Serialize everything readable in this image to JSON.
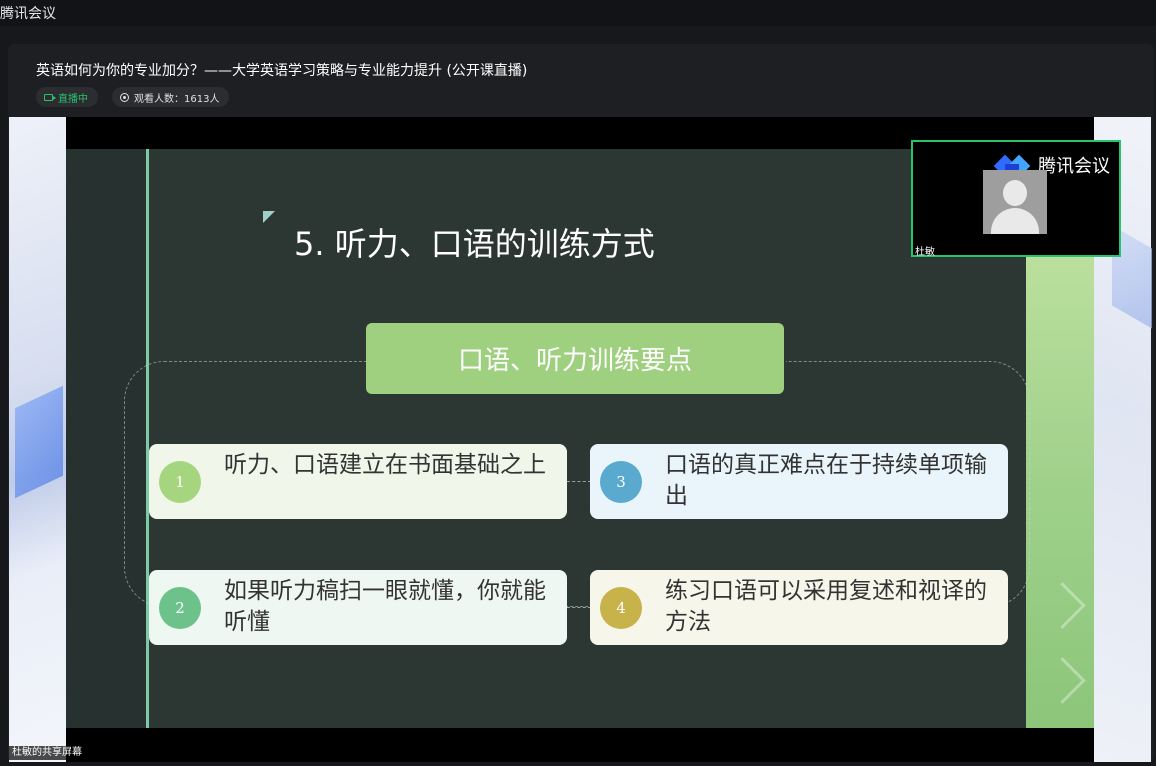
{
  "app": {
    "title": "腾讯会议"
  },
  "meeting": {
    "title": "英语如何为你的专业加分？——大学英语学习策略与专业能力提升 (公开课直播)",
    "live_label": "直播中",
    "viewers_label": "观看人数：1613人"
  },
  "share": {
    "label": "杜敏的共享屏幕"
  },
  "video_tile": {
    "logo_text": "腾讯会议",
    "name": "杜敏"
  },
  "slide": {
    "heading": "5. 听力、口语的训练方式",
    "banner": "口语、听力训练要点",
    "points": [
      {
        "num": "1",
        "text": "听力、口语建立在书面基础之上"
      },
      {
        "num": "2",
        "text": "如果听力稿扫一眼就懂，你就能听懂"
      },
      {
        "num": "3",
        "text": "口语的真正难点在于持续单项输出"
      },
      {
        "num": "4",
        "text": "练习口语可以采用复述和视译的方法"
      }
    ]
  },
  "colors": {
    "accent_green": "#27c46b",
    "slide_bg": "#2c3734",
    "banner_green": "#9fd080",
    "num1": "#a6d57f",
    "num2": "#6cc28a",
    "num3": "#5aa9cf",
    "num4": "#c8b24a"
  },
  "icons": {
    "live": "camera-icon",
    "viewers": "eye-icon",
    "logo": "tencent-meeting-logo-icon",
    "avatar": "person-avatar-icon"
  }
}
